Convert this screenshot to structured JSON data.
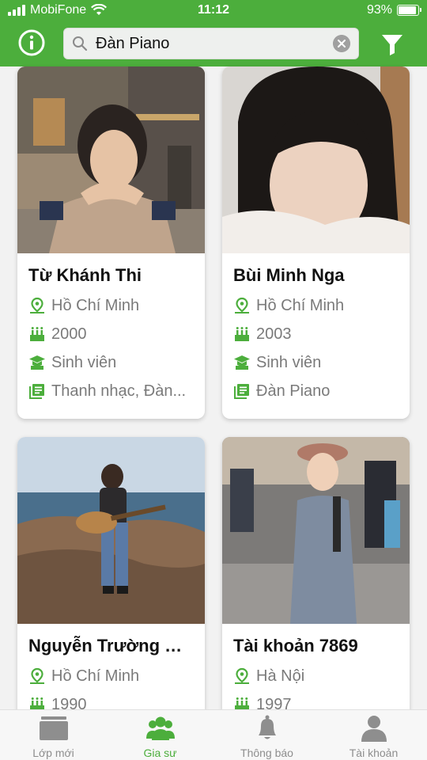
{
  "status_bar": {
    "carrier": "MobiFone",
    "time": "11:12",
    "battery": "93%",
    "battery_level": 0.93
  },
  "header": {
    "info_icon": "info-circle-icon",
    "filter_icon": "filter-icon"
  },
  "search": {
    "value": "Đàn Piano",
    "placeholder": "",
    "search_icon": "search-icon",
    "clear_icon": "clear-icon"
  },
  "colors": {
    "brand": "#4cae3c",
    "muted_text": "#7a7a7a"
  },
  "tutors": [
    {
      "name": "Từ Khánh Thi",
      "location": "Hồ Chí Minh",
      "birth_year": "2000",
      "occupation": "Sinh viên",
      "subjects": "Thanh nhạc, Đàn..."
    },
    {
      "name": "Bùi Minh Nga",
      "location": "Hồ Chí Minh",
      "birth_year": "2003",
      "occupation": "Sinh viên",
      "subjects": "Đàn Piano"
    },
    {
      "name": "Nguyễn Trường Ch...",
      "location": "Hồ Chí Minh",
      "birth_year": "1990"
    },
    {
      "name": "Tài khoản 7869",
      "location": "Hà Nội",
      "birth_year": "1997"
    }
  ],
  "bottom_nav": [
    {
      "label": "Lớp mới",
      "icon": "classes-icon",
      "active": false
    },
    {
      "label": "Gia sư",
      "icon": "tutors-icon",
      "active": true
    },
    {
      "label": "Thông báo",
      "icon": "bell-icon",
      "active": false
    },
    {
      "label": "Tài khoản",
      "icon": "account-icon",
      "active": false
    }
  ]
}
